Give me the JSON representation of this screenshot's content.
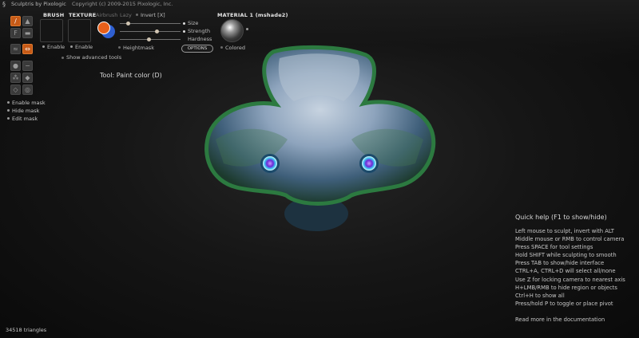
{
  "titlebar": {
    "app": "Sculptris by Pixologic",
    "copyright": "Copyright (c) 2009-2015 Pixologic, Inc."
  },
  "brush": {
    "label": "BRUSH",
    "enable": "Enable"
  },
  "texture": {
    "label": "TEXTURE",
    "enable": "Enable"
  },
  "toggles": {
    "airbrush": "Airbrush",
    "lazy": "Lazy",
    "invert": "Invert [X]"
  },
  "sliders": {
    "size": {
      "label": "Size",
      "value": 0.2
    },
    "strength": {
      "label": "Strength",
      "value": 0.62
    },
    "hardness": {
      "label": "Hardness",
      "value": 0.5
    }
  },
  "heightmask": "Heightmask",
  "options": "OPTIONS",
  "material": {
    "label": "MATERIAL 1 (mshade2)",
    "colored": "Colored"
  },
  "show_advanced": "Show advanced tools",
  "tool_label": "Tool: Paint color (D)",
  "mask": [
    "Enable mask",
    "Hide mask",
    "Edit mask"
  ],
  "colors": {
    "primary": "#e8601a",
    "secondary": "#2f5fd0",
    "accent": "#c65a17"
  },
  "icons": [
    "brush-icon",
    "fill-icon",
    "smooth-icon",
    "stroke-icon",
    "symmetry-icon",
    "mask-icon"
  ],
  "quickhelp": {
    "title": "Quick help (F1 to show/hide)",
    "lines": [
      "Left mouse to sculpt, invert with ALT",
      "Middle mouse or RMB to control camera",
      "Press SPACE for tool settings",
      "Hold SHIFT while sculpting to smooth",
      "Press TAB to show/hide interface",
      "CTRL+A, CTRL+D will select all/none",
      "Use Z for locking camera to nearest axis",
      "H+LMB/RMB to hide region or objects",
      "Ctrl+H to show all",
      "Press/hold P to toggle or place pivot"
    ],
    "more": "Read more in the documentation"
  },
  "triangles": "34518 triangles"
}
